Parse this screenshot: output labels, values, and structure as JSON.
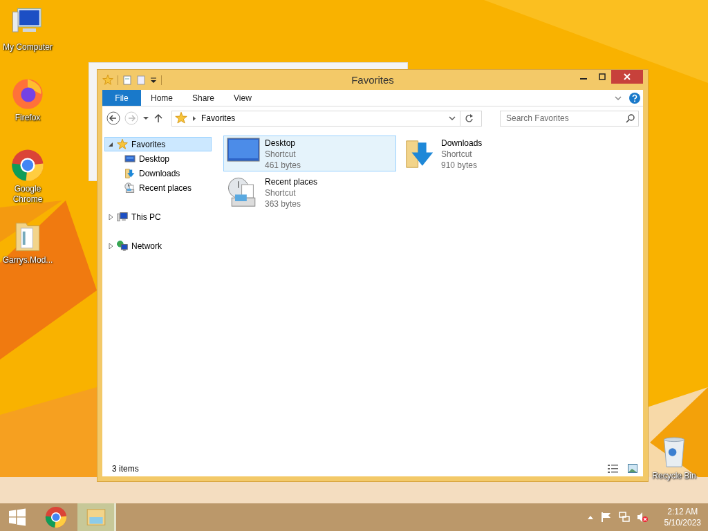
{
  "desktop_icons": [
    {
      "label": "My Computer",
      "kind": "computer"
    },
    {
      "label": "Firefox",
      "kind": "firefox"
    },
    {
      "label": "Google Chrome",
      "kind": "chrome"
    },
    {
      "label": "Garrys.Mod...",
      "kind": "folder"
    },
    {
      "label": "Recycle Bin",
      "kind": "bin"
    }
  ],
  "window": {
    "title": "Favorites",
    "ribbon_tabs": [
      {
        "label": "File",
        "kind": "menu"
      },
      {
        "label": "Home",
        "kind": "tab"
      },
      {
        "label": "Share",
        "kind": "tab"
      },
      {
        "label": "View",
        "kind": "tab"
      }
    ],
    "address": {
      "path": "Favorites"
    },
    "search": {
      "placeholder": "Search Favorites"
    },
    "nav": [
      {
        "label": "Favorites",
        "kind": "star",
        "selected": true,
        "expanded": true,
        "children": [
          {
            "label": "Desktop",
            "kind": "desktop",
            "selected": false
          },
          {
            "label": "Downloads",
            "kind": "download",
            "selected": false
          },
          {
            "label": "Recent places",
            "kind": "recent",
            "selected": false
          }
        ]
      },
      {
        "label": "This PC",
        "kind": "pc",
        "selected": false,
        "expanded": false
      },
      {
        "label": "Network",
        "kind": "network",
        "selected": false,
        "expanded": false
      }
    ],
    "items": [
      {
        "name": "Desktop",
        "type": "Shortcut",
        "size": "461 bytes",
        "kind": "desktop",
        "selected": true
      },
      {
        "name": "Downloads",
        "type": "Shortcut",
        "size": "910 bytes",
        "kind": "download",
        "selected": false
      },
      {
        "name": "Recent places",
        "type": "Shortcut",
        "size": "363 bytes",
        "kind": "recent",
        "selected": false
      }
    ],
    "status": "3 items"
  },
  "taskbar": {
    "apps": [
      {
        "kind": "chrome",
        "selected": false
      },
      {
        "kind": "explorer",
        "selected": true
      }
    ],
    "time": "2:12 AM",
    "date": "5/10/2023"
  }
}
